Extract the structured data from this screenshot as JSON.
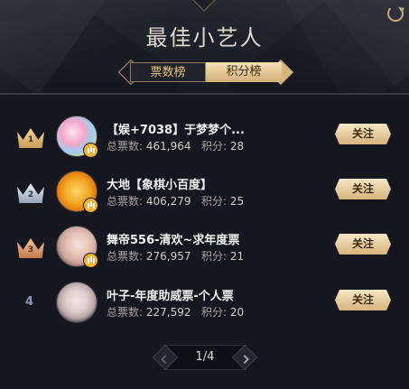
{
  "header": {
    "title": "最佳小艺人"
  },
  "tabs": [
    {
      "label": "票数榜",
      "active": false
    },
    {
      "label": "积分榜",
      "active": true
    }
  ],
  "labels": {
    "votes": "总票数:",
    "points": "积分:",
    "follow": "关注"
  },
  "rows": [
    {
      "rank": "1",
      "name": "【娱+7038】于梦梦个...",
      "votes": "461,964",
      "points": "28"
    },
    {
      "rank": "2",
      "name": "大地【象棋小百度】",
      "votes": "406,279",
      "points": "25"
    },
    {
      "rank": "3",
      "name": "舞帝556-清欢~求年度票",
      "votes": "276,957",
      "points": "21"
    },
    {
      "rank": "4",
      "name": "叶子-年度助威票-个人票",
      "votes": "227,592",
      "points": "20"
    }
  ],
  "pager": {
    "text": "1/4"
  },
  "colors": {
    "gold": "#d7b47c",
    "silver": "#b9c2d3",
    "bronze": "#d7956a",
    "badge": "#f2b233"
  }
}
